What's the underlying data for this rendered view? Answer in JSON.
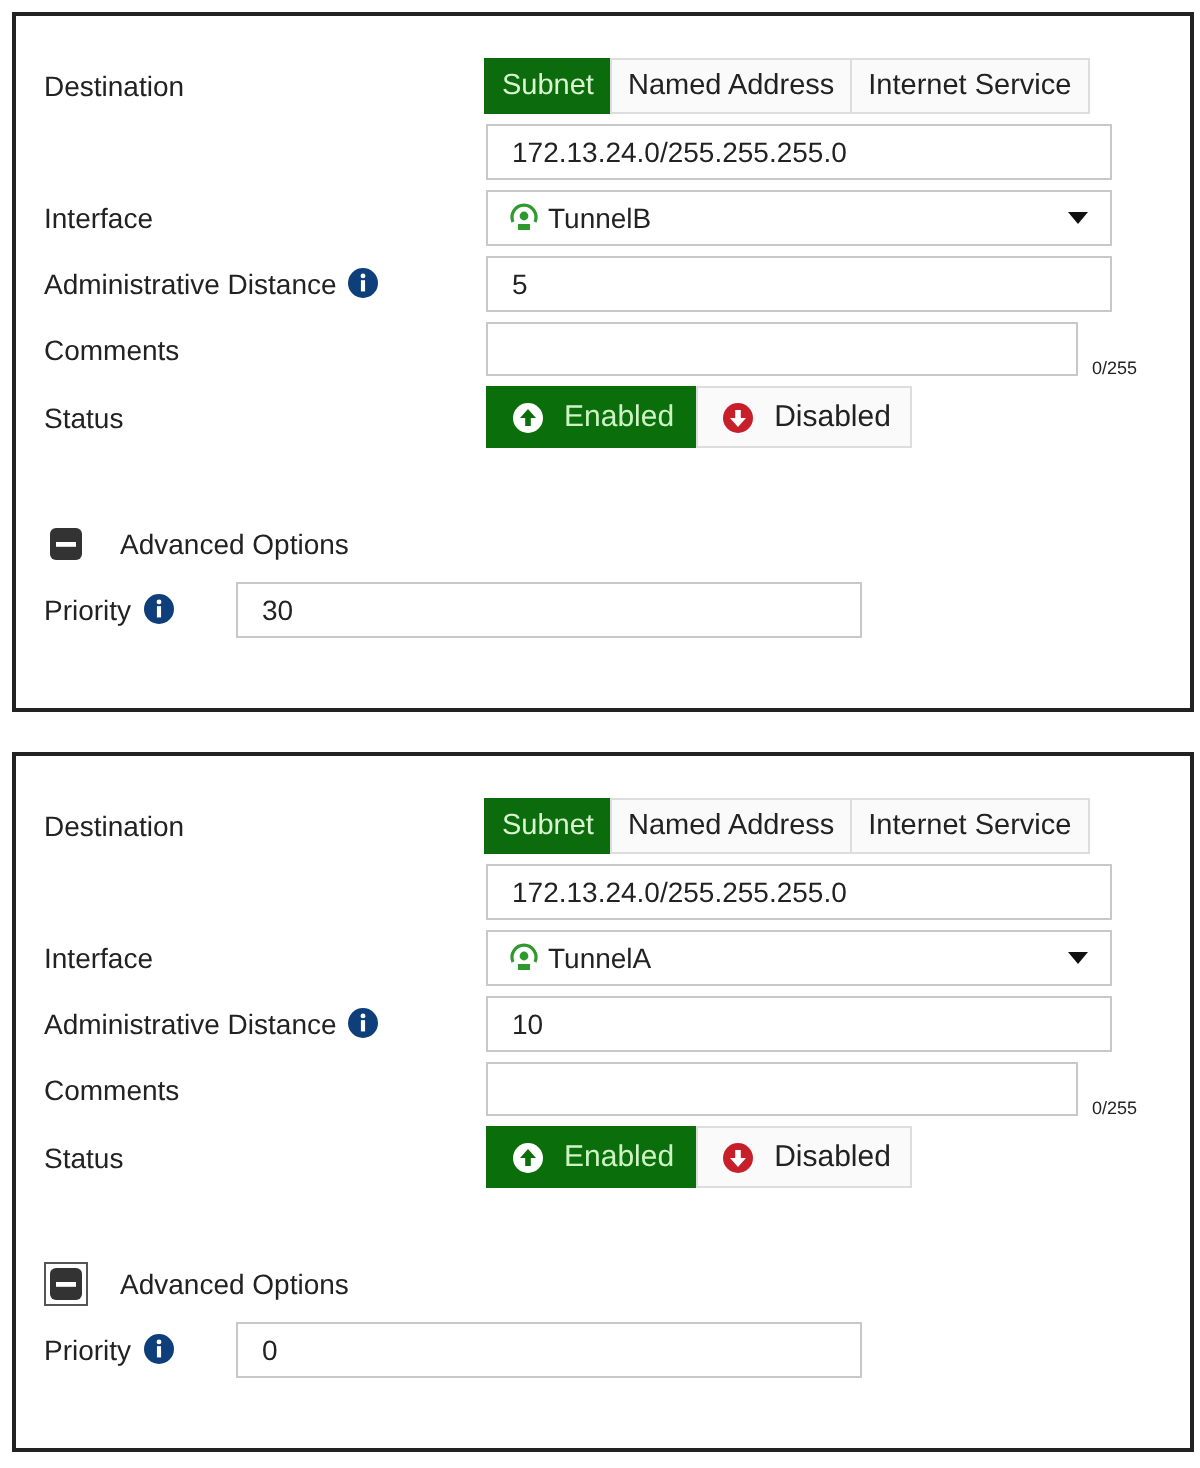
{
  "panels": [
    {
      "destination": {
        "label": "Destination",
        "tabs": [
          {
            "label": "Subnet",
            "selected": true
          },
          {
            "label": "Named Address",
            "selected": false
          },
          {
            "label": "Internet Service",
            "selected": false
          }
        ],
        "value": "172.13.24.0/255.255.255.0"
      },
      "interface": {
        "label": "Interface",
        "value": "TunnelB"
      },
      "distance": {
        "label": "Administrative Distance",
        "value": "5"
      },
      "comments": {
        "label": "Comments",
        "counter": "0/255"
      },
      "status": {
        "label": "Status",
        "options": [
          {
            "label": "Enabled",
            "kind": "up",
            "selected": true
          },
          {
            "label": "Disabled",
            "kind": "down",
            "selected": false
          }
        ]
      },
      "advanced": {
        "label": "Advanced Options",
        "expanded": true,
        "focused": false
      },
      "priority": {
        "label": "Priority",
        "value": "30"
      }
    },
    {
      "destination": {
        "label": "Destination",
        "tabs": [
          {
            "label": "Subnet",
            "selected": true
          },
          {
            "label": "Named Address",
            "selected": false
          },
          {
            "label": "Internet Service",
            "selected": false
          }
        ],
        "value": "172.13.24.0/255.255.255.0"
      },
      "interface": {
        "label": "Interface",
        "value": "TunnelA"
      },
      "distance": {
        "label": "Administrative Distance",
        "value": "10"
      },
      "comments": {
        "label": "Comments",
        "counter": "0/255"
      },
      "status": {
        "label": "Status",
        "options": [
          {
            "label": "Enabled",
            "kind": "up",
            "selected": true
          },
          {
            "label": "Disabled",
            "kind": "down",
            "selected": false
          }
        ]
      },
      "advanced": {
        "label": "Advanced Options",
        "expanded": true,
        "focused": true
      },
      "priority": {
        "label": "Priority",
        "value": "0"
      }
    }
  ]
}
